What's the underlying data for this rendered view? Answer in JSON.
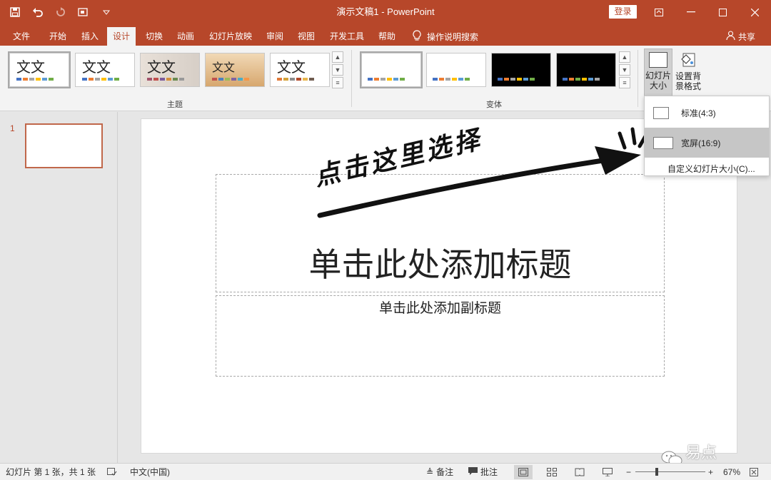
{
  "window": {
    "title": "演示文稿1  -  PowerPoint",
    "login_label": "登录",
    "accent_color": "#b7472a"
  },
  "qat": {
    "icons": [
      "save-icon",
      "undo-icon",
      "redo-icon",
      "start-from-beginning-icon",
      "customize-qat-icon"
    ]
  },
  "tabs": [
    "文件",
    "开始",
    "插入",
    "设计",
    "切换",
    "动画",
    "幻灯片放映",
    "审阅",
    "视图",
    "开发工具",
    "帮助"
  ],
  "active_tab": "设计",
  "tell_me": "操作说明搜索",
  "share": "共享",
  "ribbon": {
    "themes_label": "主题",
    "theme_sample_text": "文文",
    "variants_label": "变体",
    "slide_size_btn": "幻灯片\n大小",
    "bg_format_btn": "设置背\n景格式"
  },
  "dropdown": {
    "standard": "标准(4:3)",
    "widescreen": "宽屏(16:9)",
    "custom": "自定义幻灯片大小(C)..."
  },
  "thumbnail_panel": {
    "slide_number": "1"
  },
  "slide": {
    "title_placeholder": "单击此处添加标题",
    "subtitle_placeholder": "单击此处添加副标题",
    "annotation": "点击这里选择",
    "watermark": "易点PPT"
  },
  "statusbar": {
    "slide_info": "幻灯片 第 1 张，共 1 张",
    "language": "中文(中国)",
    "notes": "备注",
    "comments": "批注",
    "zoom": "67%",
    "zoom_fraction": 0.67
  }
}
